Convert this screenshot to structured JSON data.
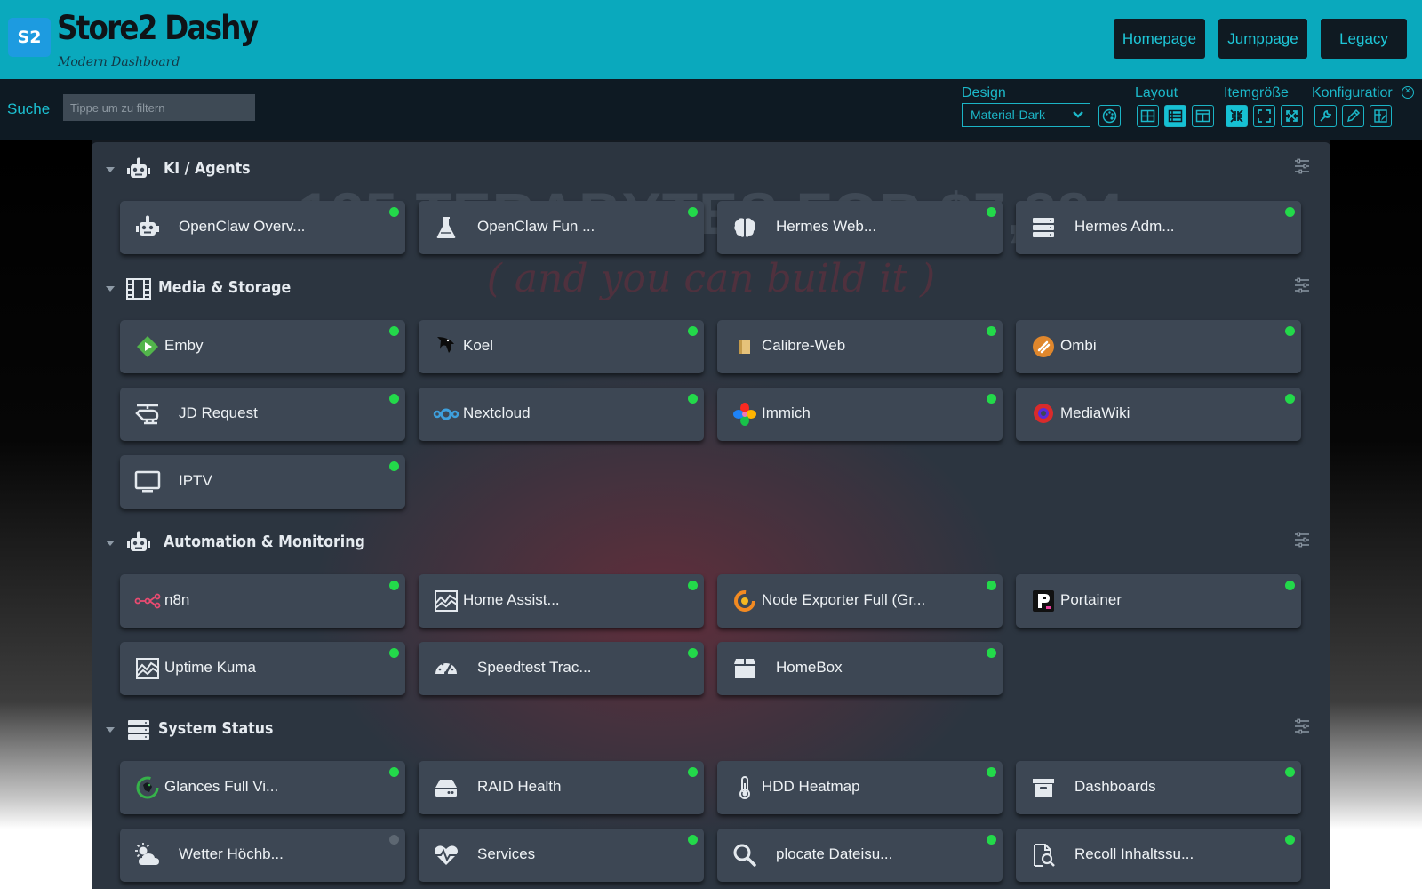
{
  "header": {
    "logo": "S2",
    "title": "Store2 Dashy",
    "subtitle": "Modern Dashboard",
    "nav": [
      "Homepage",
      "Jumppage",
      "Legacy"
    ]
  },
  "toolbar": {
    "search_label": "Suche",
    "search_placeholder": "Tippe um zu filtern",
    "design_label": "Design",
    "design_value": "Material-Dark",
    "layout_label": "Layout",
    "itemsize_label": "Itemgröße",
    "config_label": "Konfiguratior"
  },
  "background": {
    "headline": "135 TERABYTES FOR  $7,384",
    "subline": "( and you can build it )"
  },
  "colors": {
    "header": "#0aa9bd",
    "accent": "#1cb8c9",
    "tile": "#3d4754",
    "status_online": "#23d94a",
    "status_unknown": "#5d6772"
  },
  "sections": [
    {
      "title": "KI / Agents",
      "icon": "robot-icon",
      "items": [
        {
          "label": "OpenClaw Overv...",
          "icon": "robot-icon",
          "status": "online"
        },
        {
          "label": "OpenClaw Fun ...",
          "icon": "flask-icon",
          "status": "online"
        },
        {
          "label": "Hermes Web...",
          "icon": "brain-icon",
          "status": "online"
        },
        {
          "label": "Hermes Adm...",
          "icon": "server-icon",
          "status": "online"
        }
      ]
    },
    {
      "title": "Media & Storage",
      "icon": "film-icon",
      "items": [
        {
          "label": "Emby",
          "icon": "emby-icon",
          "status": "online"
        },
        {
          "label": "Koel",
          "icon": "koel-bird-icon",
          "status": "online"
        },
        {
          "label": "Calibre-Web",
          "icon": "book-icon",
          "status": "online"
        },
        {
          "label": "Ombi",
          "icon": "ombi-icon",
          "status": "online"
        },
        {
          "label": "JD Request",
          "icon": "helicopter-icon",
          "status": "online"
        },
        {
          "label": "Nextcloud",
          "icon": "nextcloud-icon",
          "status": "online"
        },
        {
          "label": "Immich",
          "icon": "immich-pinwheel-icon",
          "status": "online"
        },
        {
          "label": "MediaWiki",
          "icon": "mediawiki-icon",
          "status": "online"
        },
        {
          "label": "IPTV",
          "icon": "tv-icon",
          "status": "online"
        }
      ]
    },
    {
      "title": "Automation & Monitoring",
      "icon": "robot-icon",
      "items": [
        {
          "label": "n8n",
          "icon": "n8n-icon",
          "status": "online"
        },
        {
          "label": "Home Assist...",
          "icon": "chart-area-icon",
          "status": "online"
        },
        {
          "label": "Node Exporter Full (Gr...",
          "icon": "grafana-icon",
          "status": "online"
        },
        {
          "label": "Portainer",
          "icon": "portainer-icon",
          "status": "online"
        },
        {
          "label": "Uptime Kuma",
          "icon": "chart-area-icon",
          "status": "online"
        },
        {
          "label": "Speedtest Trac...",
          "icon": "speedometer-icon",
          "status": "online"
        },
        {
          "label": "HomeBox",
          "icon": "box-icon",
          "status": "online"
        }
      ]
    },
    {
      "title": "System Status",
      "icon": "server-icon",
      "items": [
        {
          "label": "Glances Full Vi...",
          "icon": "glances-icon",
          "status": "online"
        },
        {
          "label": "RAID Health",
          "icon": "hdd-icon",
          "status": "online"
        },
        {
          "label": "HDD Heatmap",
          "icon": "thermometer-icon",
          "status": "online"
        },
        {
          "label": "Dashboards",
          "icon": "archive-icon",
          "status": "online"
        },
        {
          "label": "Wetter Höchb...",
          "icon": "cloud-sun-icon",
          "status": "unknown"
        },
        {
          "label": "Services",
          "icon": "heartbeat-icon",
          "status": "online"
        },
        {
          "label": "plocate Dateisu...",
          "icon": "search-icon",
          "status": "online"
        },
        {
          "label": "Recoll Inhaltssu...",
          "icon": "file-search-icon",
          "status": "online"
        }
      ]
    }
  ]
}
